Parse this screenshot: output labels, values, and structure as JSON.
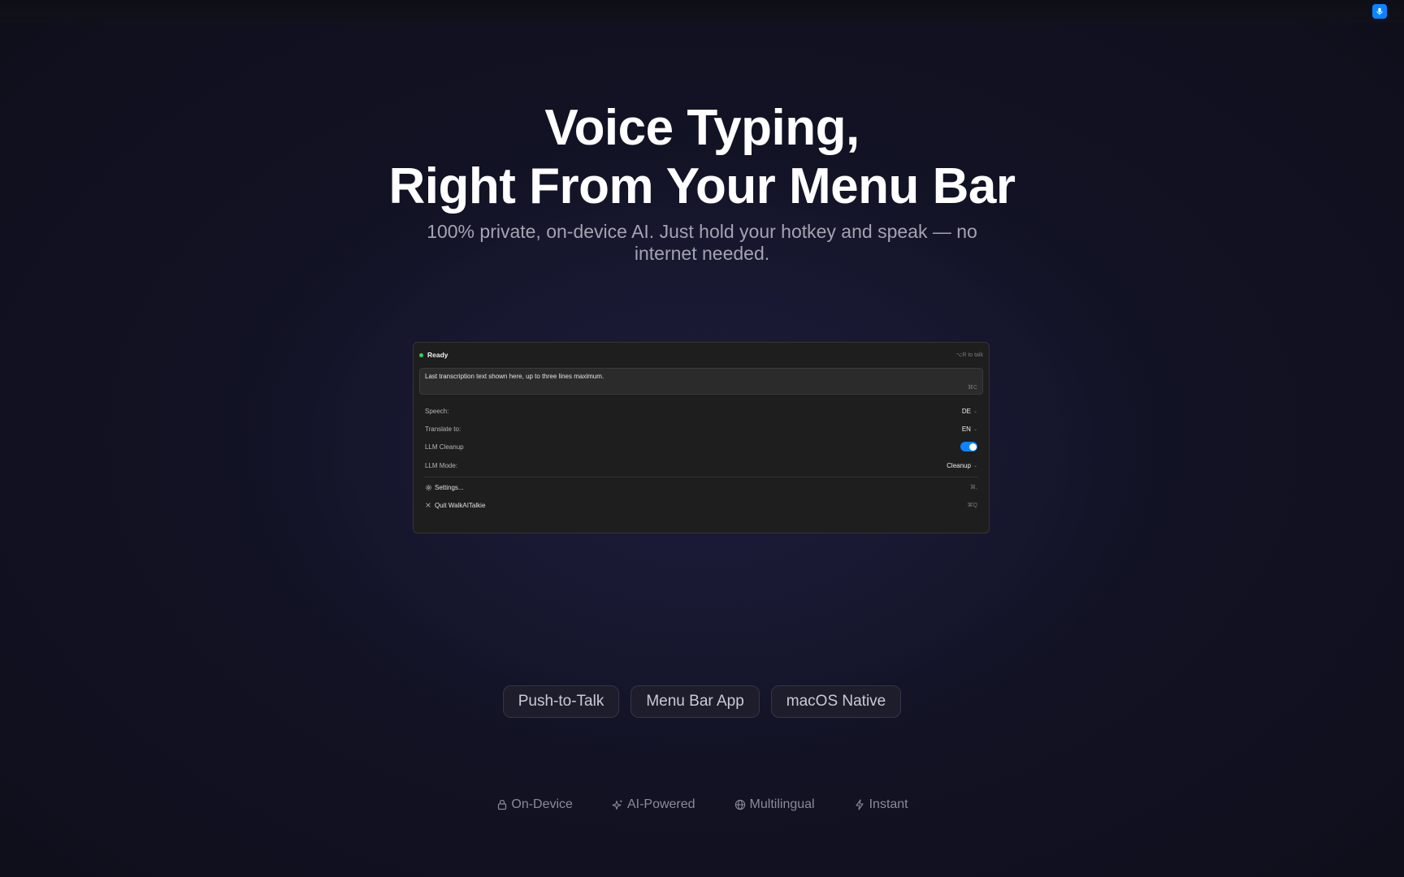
{
  "colors": {
    "accent": "#0a84ff",
    "ready_status": "#30d158"
  },
  "menubar": {
    "mic_icon": "microphone-icon"
  },
  "hero": {
    "title_line1": "Voice Typing,",
    "title_line2": "Right From Your Menu Bar",
    "subtitle": "100% private, on-device AI. Just hold your hotkey and speak — no internet needed."
  },
  "popover": {
    "status": "Ready",
    "hotkey_hint": "⌥R to talk",
    "transcript": "Last transcription text shown here, up to three lines maximum.",
    "copy_shortcut": "⌘C",
    "settings_rows": [
      {
        "label": "Speech:",
        "value": "DE"
      },
      {
        "label": "Translate to:",
        "value": "EN"
      },
      {
        "label": "LLM Cleanup",
        "toggle_on": true
      },
      {
        "label": "LLM Mode:",
        "value": "Cleanup"
      }
    ],
    "actions": [
      {
        "label": "Settings...",
        "shortcut": "⌘,",
        "icon": "gear-icon"
      },
      {
        "label": "Quit WalkAITalkie",
        "shortcut": "⌘Q",
        "icon": "close-icon"
      }
    ]
  },
  "pills": [
    "Push-to-Talk",
    "Menu Bar App",
    "macOS Native"
  ],
  "features": [
    {
      "label": "On-Device",
      "icon": "lock-icon"
    },
    {
      "label": "AI-Powered",
      "icon": "sparkles-icon"
    },
    {
      "label": "Multilingual",
      "icon": "globe-icon"
    },
    {
      "label": "Instant",
      "icon": "lightning-icon"
    }
  ]
}
